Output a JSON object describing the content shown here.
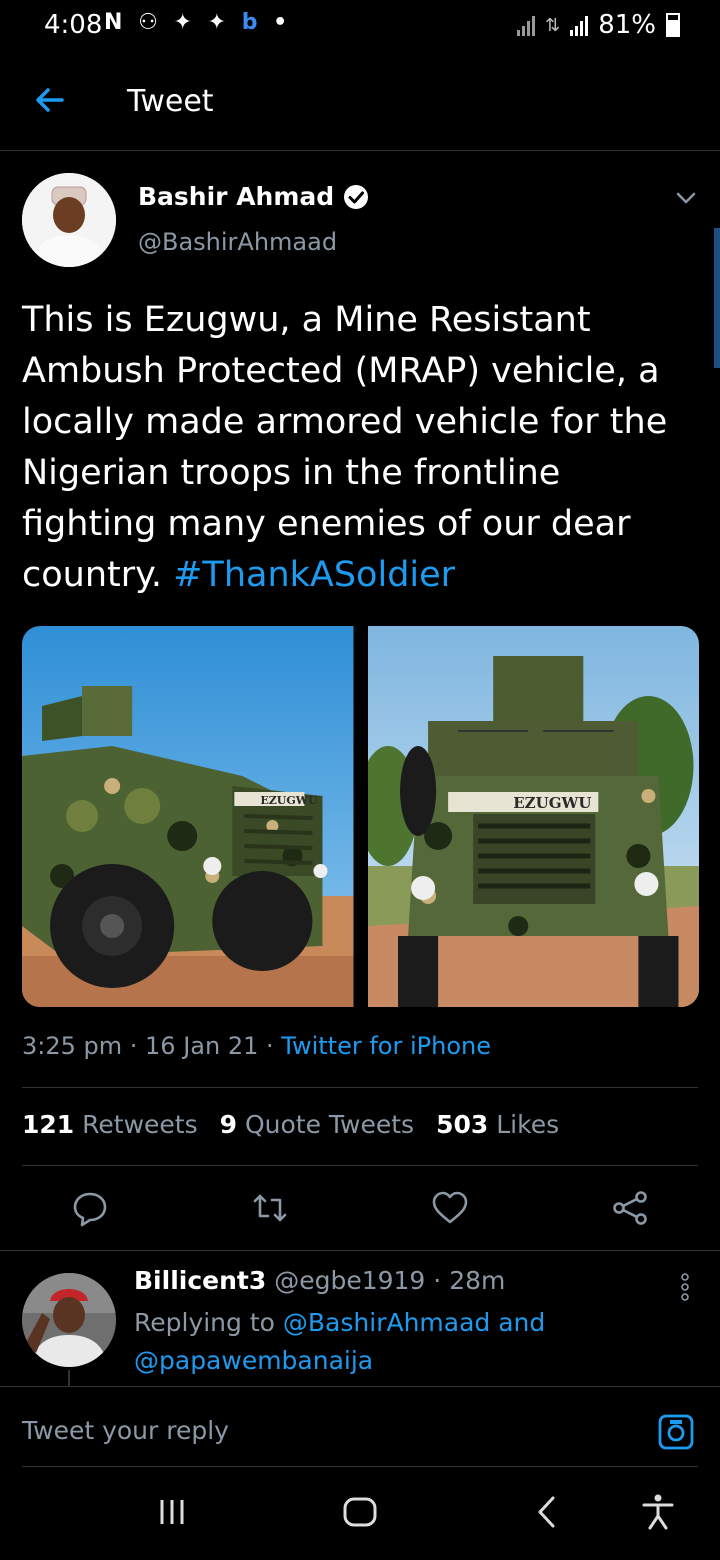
{
  "status_bar": {
    "time": "4:08",
    "battery": "81%"
  },
  "header": {
    "title": "Tweet"
  },
  "tweet": {
    "author_name": "Bashir Ahmad",
    "author_handle": "@BashirAhmaad",
    "text_main": "This is Ezugwu, a Mine Resistant Ambush Protected (MRAP) vehicle, a locally made armored vehicle for the Nigerian troops in the frontline fighting many enemies of our dear country. ",
    "hashtag": "#ThankASoldier",
    "time": "3:25 pm",
    "date": "16 Jan 21",
    "source": "Twitter for iPhone",
    "retweets_count": "121",
    "retweets_label": "Retweets",
    "quotes_count": "9",
    "quotes_label": "Quote Tweets",
    "likes_count": "503",
    "likes_label": "Likes",
    "media_label_left": "EZUGWU",
    "media_label_right": "EZUGWU"
  },
  "reply": {
    "author_name": "Billicent3",
    "author_handle": "@egbe1919",
    "age": "28m",
    "replying_prefix": "Replying to",
    "mention1": "@BashirAhmaad",
    "and_word": "and",
    "mention2": "@papawembanaija"
  },
  "composer": {
    "placeholder": "Tweet your reply"
  },
  "colors": {
    "accent": "#1d9bf0",
    "background": "#000000",
    "muted": "#8b98a5"
  }
}
